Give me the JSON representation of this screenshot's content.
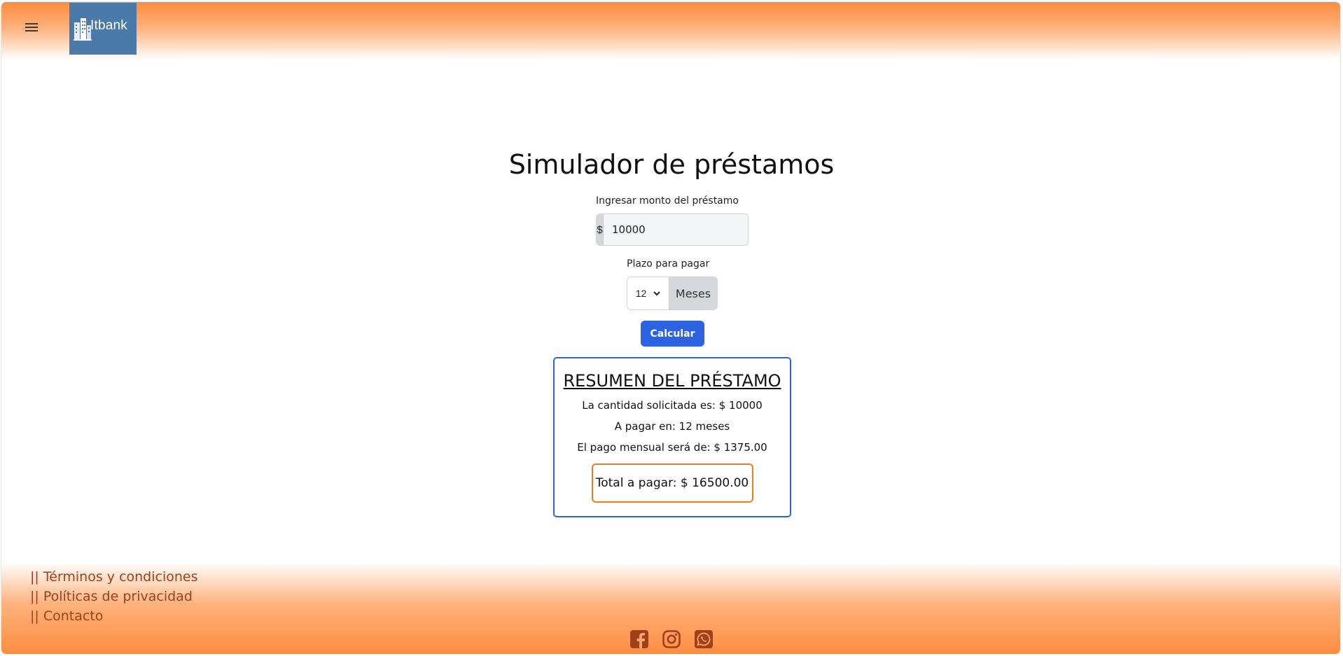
{
  "header": {
    "menu_icon": "hamburger-icon",
    "logo_text": "Itbank",
    "logo_icon": "buildings-icon",
    "brand_color": "#4a7aaa",
    "gradient_color": "#fd8c3f"
  },
  "main": {
    "title": "Simulador de préstamos",
    "amount": {
      "label": "Ingresar monto del préstamo",
      "prefix": "$",
      "value": "10000"
    },
    "term": {
      "label": "Plazo para pagar",
      "selected": "12",
      "suffix": "Meses"
    },
    "calculate_label": "Calcular",
    "summary": {
      "title": "RESUMEN DEL PRÉSTAMO",
      "requested": "La cantidad solicitada es: $ 10000",
      "term_text": "A pagar en: 12 meses",
      "monthly": "El pago mensual será de: $ 1375.00",
      "total": "Total a pagar: $ 16500.00",
      "border_color": "#2c63e0",
      "total_border_color": "#f07a1e"
    }
  },
  "footer": {
    "links": [
      "|| Términos y condiciones",
      "|| Políticas de privacidad",
      "|| Contacto"
    ],
    "link_color": "#a0401a",
    "social_icons": [
      "facebook-icon",
      "instagram-icon",
      "whatsapp-icon"
    ]
  }
}
